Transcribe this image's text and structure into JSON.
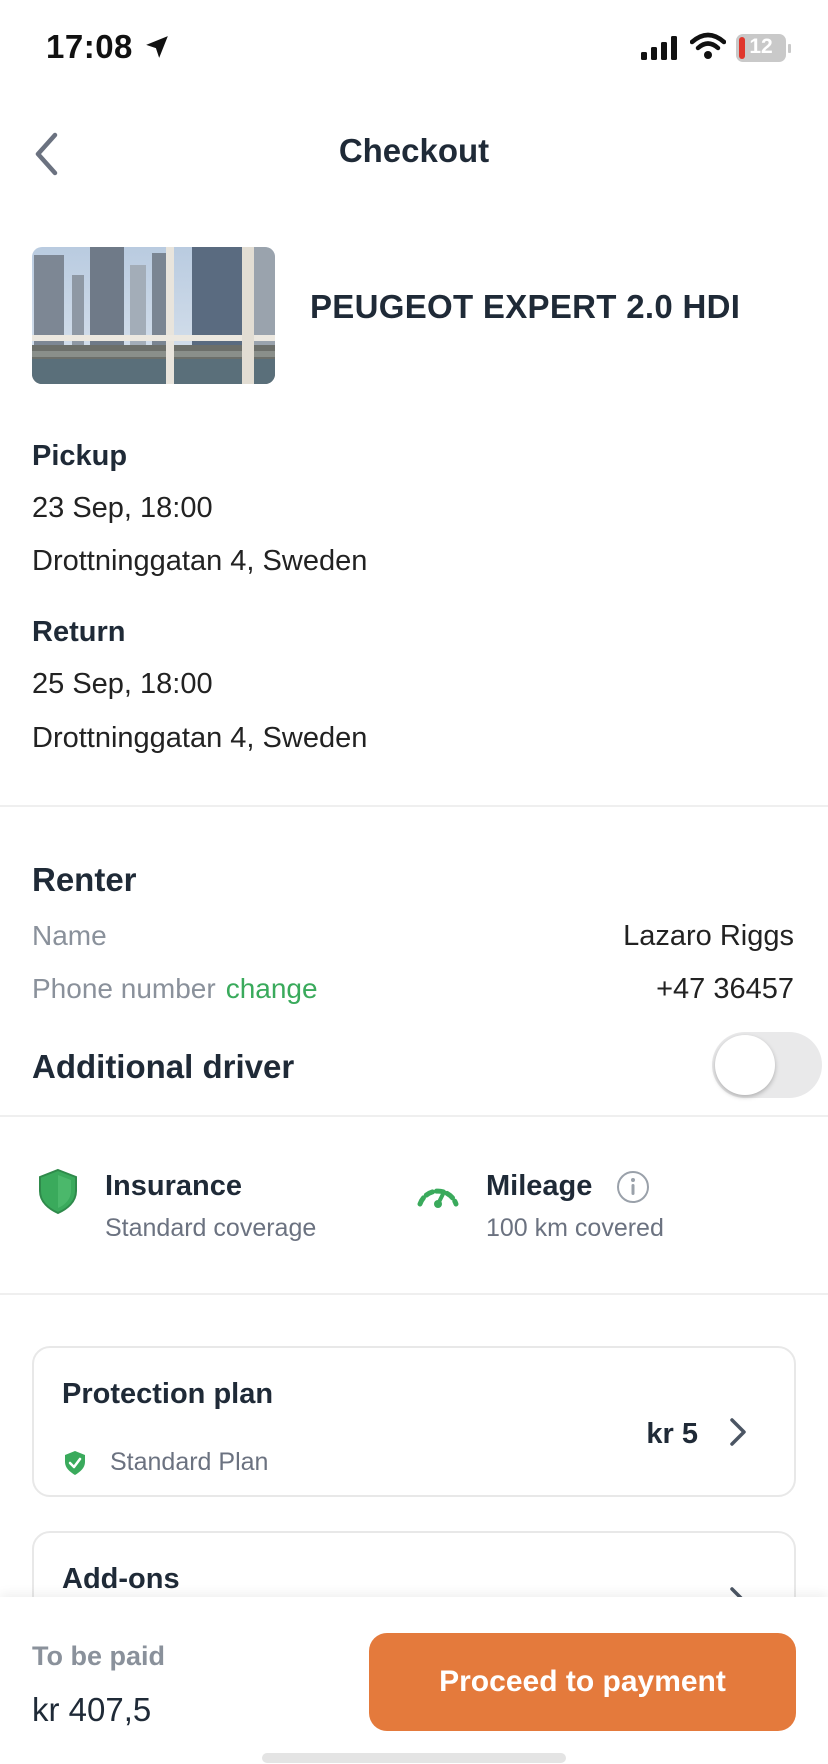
{
  "status_bar": {
    "time": "17:08",
    "battery": "12"
  },
  "header": {
    "title": "Checkout"
  },
  "car": {
    "name": "PEUGEOT EXPERT 2.0 HDI"
  },
  "trip": {
    "pickup_label": "Pickup",
    "pickup_datetime": "23 Sep, 18:00",
    "pickup_location": "Drottninggatan 4, Sweden",
    "return_label": "Return",
    "return_datetime": "25 Sep, 18:00",
    "return_location": "Drottninggatan 4, Sweden"
  },
  "renter": {
    "heading": "Renter",
    "name_label": "Name",
    "name_value": "Lazaro Riggs",
    "phone_label": "Phone number",
    "phone_change": "change",
    "phone_value": "+47 36457",
    "additional_driver_label": "Additional driver",
    "additional_driver_enabled": false
  },
  "features": {
    "insurance_title": "Insurance",
    "insurance_subtitle": "Standard coverage",
    "mileage_title": "Mileage",
    "mileage_subtitle": "100 km covered"
  },
  "protection_plan": {
    "title": "Protection plan",
    "plan_name": "Standard Plan",
    "price": "kr 5"
  },
  "addons": {
    "title": "Add-ons"
  },
  "footer": {
    "to_be_paid_label": "To be paid",
    "total": "kr 407,5",
    "pay_button": "Proceed to payment"
  },
  "colors": {
    "accent_orange": "#e47a3c",
    "accent_green": "#3aaa5c",
    "text_dark": "#1f2a37",
    "text_muted": "#8a919b"
  },
  "icons": [
    "location-arrow-icon",
    "signal-icon",
    "wifi-icon",
    "battery-icon",
    "back-chevron-icon",
    "shield-icon",
    "speedometer-icon",
    "info-icon",
    "chevron-right-icon"
  ]
}
